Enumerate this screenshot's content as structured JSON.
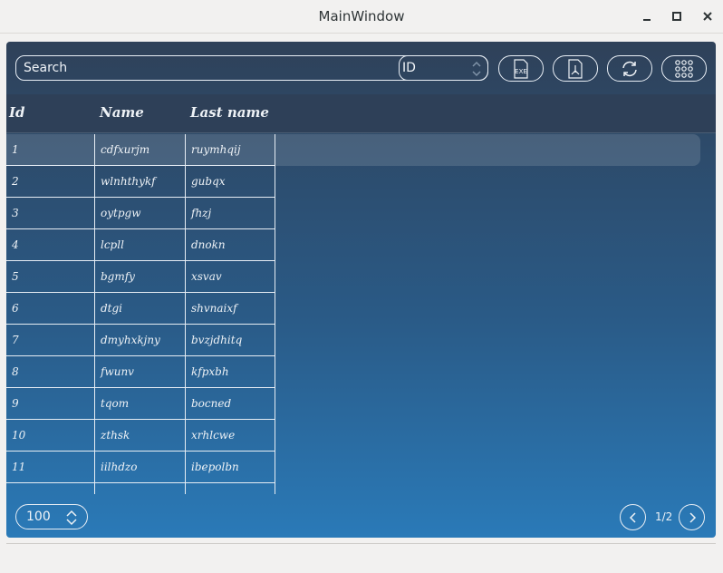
{
  "window": {
    "title": "MainWindow"
  },
  "toolbar": {
    "search_placeholder": "Search",
    "filter_value": "ID",
    "buttons": [
      "exe-export-icon",
      "pdf-export-icon",
      "refresh-icon",
      "grid-menu-icon"
    ]
  },
  "table": {
    "columns": [
      "Id",
      "Name",
      "Last name"
    ],
    "rows": [
      [
        "1",
        "cdfxurjm",
        "ruymhqij"
      ],
      [
        "2",
        "wlnhthykf",
        "gubqx"
      ],
      [
        "3",
        "oytpgw",
        "fhzj"
      ],
      [
        "4",
        "lcpll",
        "dnokn"
      ],
      [
        "5",
        "bgmfy",
        "xsvav"
      ],
      [
        "6",
        "dtgi",
        "shvnaixf"
      ],
      [
        "7",
        "dmyhxkjny",
        "bvzjdhitq"
      ],
      [
        "8",
        "fwunv",
        "kfpxbh"
      ],
      [
        "9",
        "tqom",
        "bocned"
      ],
      [
        "10",
        "zthsk",
        "xrhlcwe"
      ],
      [
        "11",
        "iilhdzo",
        "ibepolbn"
      ]
    ],
    "selected_row": 1
  },
  "pagination": {
    "page_size": "100",
    "page_label": "1/2"
  },
  "colors": {
    "panel_top": "#2f4159",
    "panel_bottom": "#2a7ab8",
    "header": "#2e4058",
    "text": "#eef2f6"
  }
}
